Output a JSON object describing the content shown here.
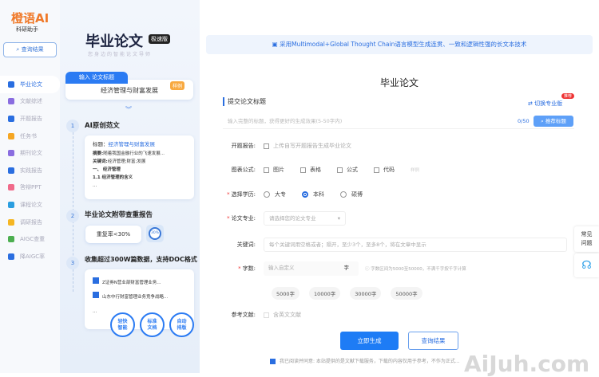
{
  "brand": {
    "name": "橙语AI",
    "subtitle": "科研助手"
  },
  "sidebar": {
    "query_label": "查询结果",
    "items": [
      {
        "label": "毕业论文",
        "color": "#2a6ee0"
      },
      {
        "label": "文献综述",
        "color": "#8a6de0"
      },
      {
        "label": "开题报告",
        "color": "#2a6ee0"
      },
      {
        "label": "任务书",
        "color": "#f5a623"
      },
      {
        "label": "期刊论文",
        "color": "#8a6de0"
      },
      {
        "label": "实践报告",
        "color": "#2a6ee0"
      },
      {
        "label": "答辩PPT",
        "color": "#f06a8a"
      },
      {
        "label": "课程论文",
        "color": "#2a9ee0"
      },
      {
        "label": "调研报告",
        "color": "#f5b623"
      },
      {
        "label": "AIGC查重",
        "color": "#4caf50"
      },
      {
        "label": "降AIGC率",
        "color": "#2a6ee0"
      }
    ]
  },
  "promo": {
    "title": "毕业论文",
    "badge": "极速版",
    "tagline": "您身边的智能论文导师",
    "input_tab": "输入 论文标题",
    "example_title": "经济管理与财富发展",
    "example_badge": "样例",
    "step1": {
      "num": "1",
      "title": "AI原创范文",
      "card_title_label": "标题：",
      "card_title": "经济管理与财富发展",
      "abstract_label": "摘要:",
      "abstract": "随着我国金融行业的飞速发展...",
      "keywords_label": "关键词:",
      "keywords": "经济管理;财富;发展",
      "h1": "一、 经济管理",
      "h2": "1.1 经济管理的含义",
      "more": "..."
    },
    "step2": {
      "num": "2",
      "title": "毕业论文附带查重报告",
      "rate": "重复率<30%",
      "ring": "30%"
    },
    "step3": {
      "num": "3",
      "title": "收集超过300W篇数据，支持DOC格式",
      "docs": [
        "Z证券N营业部财富管理业务...",
        "山东中行财富管理业务竞争战略..."
      ],
      "more": "...",
      "features": [
        [
          "轻快",
          "智能"
        ],
        [
          "标准",
          "文档"
        ],
        [
          "自动",
          "排版"
        ]
      ]
    }
  },
  "main": {
    "banner": "采用Multimodal+Global Thought Chain语言模型生成连贯、一致和逻辑性强的长文本技术",
    "title": "毕业论文",
    "section": "提交论文标题",
    "switch": "切换专业版",
    "recommend_badge": "推荐",
    "title_placeholder": "输入完整的标题，获得更好的生成效果(5-50字内)",
    "count": "0/50",
    "recommend_btn": "推荐标题",
    "proposal_label": "开题报告:",
    "proposal_option": "上传自写开题报告生成毕业论文",
    "charts_label": "图表公式:",
    "charts_options": [
      "图片",
      "表格",
      "公式",
      "代码"
    ],
    "charts_example": "样例",
    "degree_label": "选择学历:",
    "degree_options": [
      "大专",
      "本科",
      "硕博"
    ],
    "degree_selected": "本科",
    "major_label": "论文专业:",
    "major_placeholder": "请选择您的论文专业",
    "keywords_label": "关键词:",
    "keywords_placeholder": "每个关键词用空格或者；隔开，至少3个，至多8个，将在文章中显示",
    "words_label": "字数:",
    "words_placeholder": "输入自定义",
    "words_unit": "字",
    "words_hint": "字数区间为5000至50000，不满千字按千字计算",
    "word_chips": [
      "5000字",
      "10000字",
      "30000字",
      "50000字"
    ],
    "ref_label": "参考文献:",
    "ref_option": "含英文文献",
    "generate": "立即生成",
    "query": "查询结果",
    "agree": "我已阅读并同意: 本站提供的是文献下载服务，下载的内容仅用于参考，不作为正式...",
    "faq": "常见问题",
    "watermark": "AiJuh.com"
  }
}
